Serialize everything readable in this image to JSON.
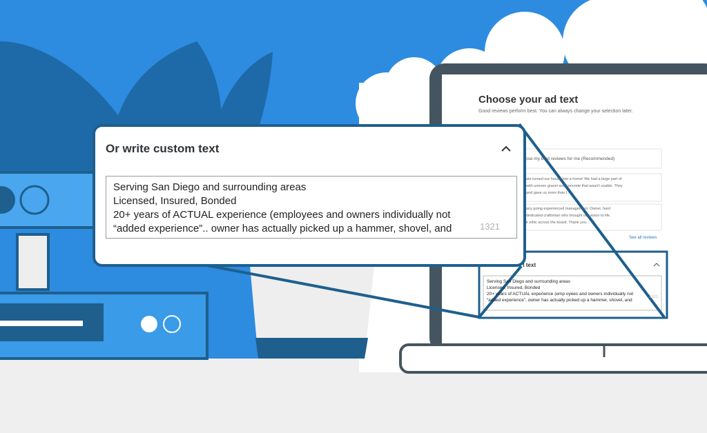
{
  "callout": {
    "title": "Or write custom text",
    "text_lines": [
      "Serving San Diego and surrounding areas",
      "Licensed, Insured, Bonded",
      "20+ years of ACTUAL experience (employees and owners individually not",
      "“added experience”.. owner has actually picked up a hammer, shovel, and"
    ],
    "char_count": "1321"
  },
  "laptop_screen": {
    "title": "Choose your ad text",
    "subtitle": "Good reviews perform best. You can always change your selection later.",
    "option_recommended": "ose my best reviews for me (Recommended)",
    "review_1": [
      "ate turned our house into a home! We had a large part of",
      "with uneven gravel and concrete that wasn't usable. They",
      "and gave us more than I..."
    ],
    "review_2": [
      "any going experienced management. Owner, hard",
      "dedicated craftsman who brought our vision to life.",
      "k ethic across the board. Thank you..."
    ],
    "see_all": "See all reviews",
    "mini_title": "t text",
    "mini_lines": [
      "Serving San Diego and surrounding areas",
      "Licensed, Insured, Bonded",
      "20+ years of ACTUAL experience (emp oyees and owners individually not",
      "“added experience”. owner has actually picked up a hammer, shovel, and"
    ],
    "mini_count": "1321"
  },
  "colors": {
    "sky": "#2d8be0",
    "dark_blue": "#1e5f8e",
    "mid_blue": "#3a9be8",
    "cloud": "#ffffff",
    "floor": "#efefef",
    "laptop_frame": "#45555f"
  }
}
